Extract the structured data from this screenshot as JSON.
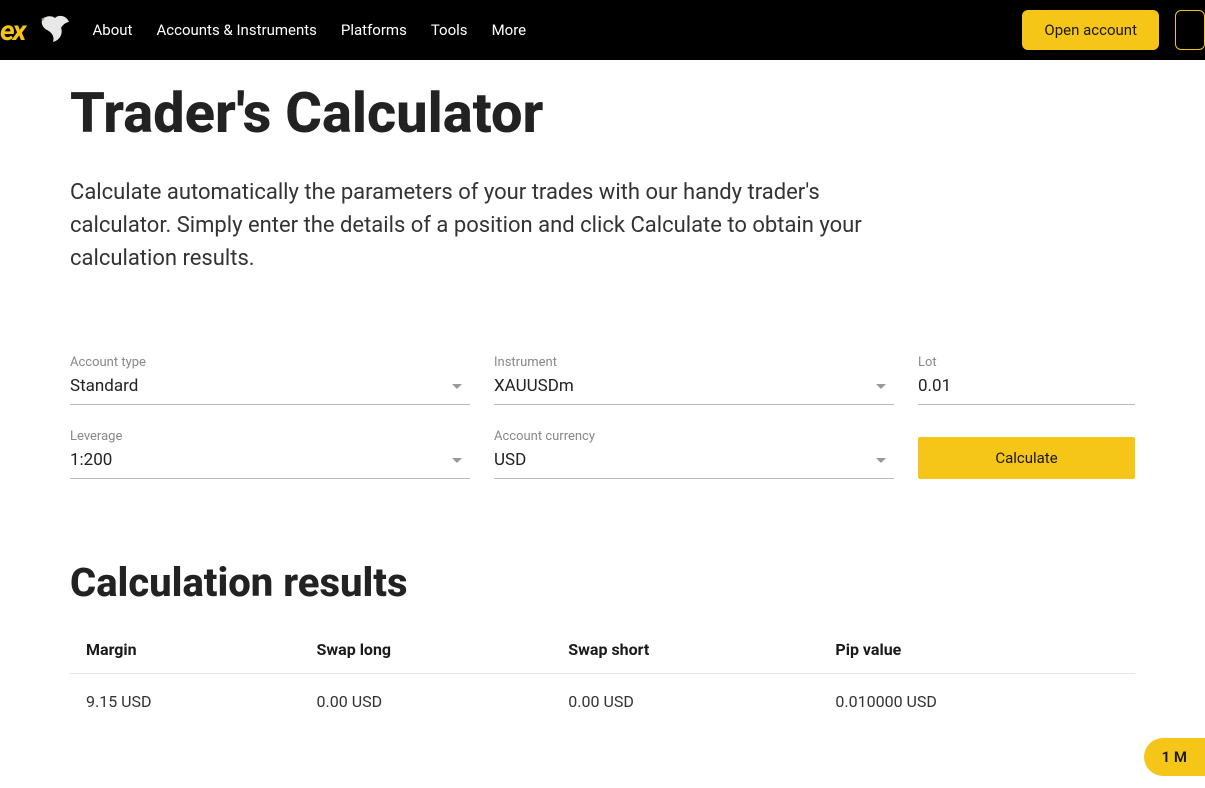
{
  "header": {
    "nav": [
      {
        "label": "About"
      },
      {
        "label": "Accounts & Instruments"
      },
      {
        "label": "Platforms"
      },
      {
        "label": "Tools"
      },
      {
        "label": "More"
      }
    ],
    "open_account_label": "Open account"
  },
  "page": {
    "title": "Trader's Calculator",
    "subtitle": "Calculate automatically the parameters of your trades with our handy trader's calculator. Simply enter the details of a position and click Calculate to obtain your calculation results."
  },
  "form": {
    "account_type": {
      "label": "Account type",
      "value": "Standard"
    },
    "instrument": {
      "label": "Instrument",
      "value": "XAUUSDm"
    },
    "lot": {
      "label": "Lot",
      "value": "0.01"
    },
    "leverage": {
      "label": "Leverage",
      "value": "1:200"
    },
    "account_currency": {
      "label": "Account currency",
      "value": "USD"
    },
    "calculate_label": "Calculate"
  },
  "results": {
    "title": "Calculation results",
    "columns": [
      "Margin",
      "Swap long",
      "Swap short",
      "Pip value"
    ],
    "row": {
      "margin": "9.15 USD",
      "swap_long": "0.00 USD",
      "swap_short": "0.00 USD",
      "pip_value": "0.010000 USD"
    }
  },
  "float_pill": {
    "label": "1 M"
  }
}
